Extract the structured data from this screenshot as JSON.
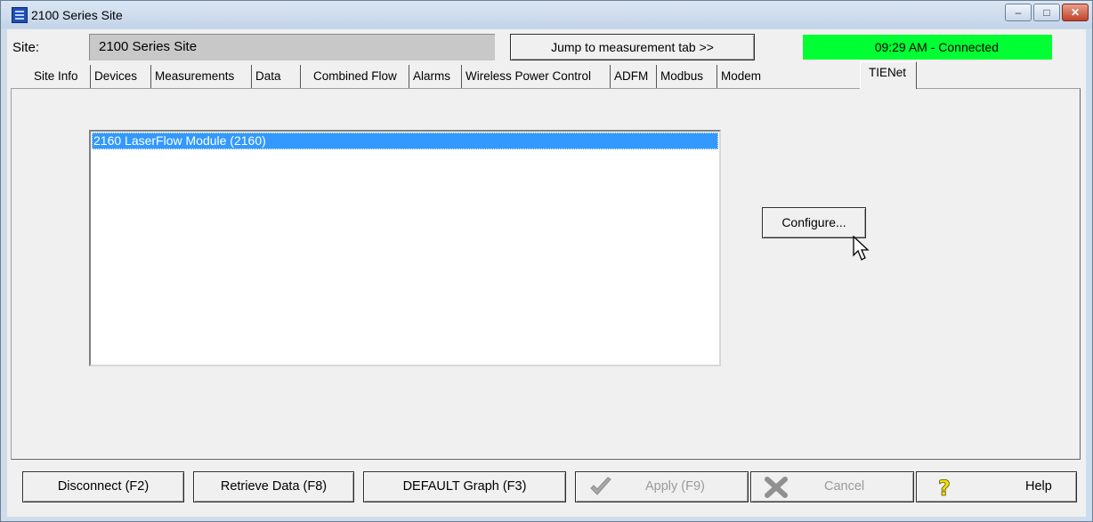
{
  "window": {
    "title": "2100 Series Site"
  },
  "site": {
    "label": "Site:",
    "value": "2100 Series Site"
  },
  "jump_button": {
    "label": "Jump to measurement tab >>"
  },
  "status": {
    "text": "09:29 AM - Connected",
    "color": "#00ff33"
  },
  "tabs": [
    {
      "label": "Site Info"
    },
    {
      "label": "Devices"
    },
    {
      "label": "Measurements"
    },
    {
      "label": "Data"
    },
    {
      "label": "Combined Flow"
    },
    {
      "label": "Alarms"
    },
    {
      "label": "Wireless Power Control"
    },
    {
      "label": "ADFM"
    },
    {
      "label": "Modbus"
    },
    {
      "label": "Modem"
    },
    {
      "label": "TIENet",
      "active": true
    }
  ],
  "list": {
    "items": [
      {
        "label": "2160 LaserFlow Module (2160)",
        "selected": true
      }
    ]
  },
  "configure_button": {
    "label": "Configure..."
  },
  "bottom": {
    "disconnect": "Disconnect (F2)",
    "retrieve": "Retrieve Data (F8)",
    "graph": "DEFAULT Graph (F3)",
    "apply": "Apply (F9)",
    "cancel": "Cancel",
    "help": "Help"
  },
  "icons": {
    "app": "app-icon",
    "apply": "checkmark-icon",
    "cancel": "x-icon",
    "help": "question-mark-icon",
    "cursor": "mouse-pointer-icon"
  }
}
